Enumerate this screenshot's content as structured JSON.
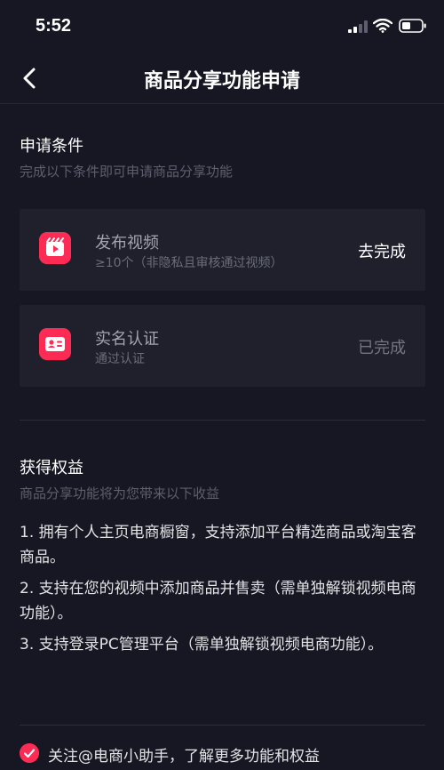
{
  "status_bar": {
    "time": "5:52",
    "icons": [
      "signal-icon",
      "wifi-icon",
      "battery-icon"
    ]
  },
  "nav": {
    "back_icon": "back-arrow-icon",
    "title": "商品分享功能申请"
  },
  "requirements": {
    "title": "申请条件",
    "subtitle": "完成以下条件即可申请商品分享功能",
    "items": [
      {
        "icon": "video-icon",
        "title": "发布视频",
        "desc": "≥10个（非隐私且审核通过视频）",
        "action": "去完成"
      },
      {
        "icon": "id-card-icon",
        "title": "实名认证",
        "desc": "通过认证",
        "action": "已完成"
      }
    ]
  },
  "benefits": {
    "title": "获得权益",
    "subtitle": "商品分享功能将为您带来以下收益",
    "items": [
      "1. 拥有个人主页电商橱窗，支持添加平台精选商品或淘宝客商品。",
      "2. 支持在您的视频中添加商品并售卖（需单独解锁视频电商功能）。",
      "3. 支持登录PC管理平台（需单独解锁视频电商功能）。"
    ]
  },
  "follow": {
    "checked": true,
    "icon": "check-circle-icon",
    "text": "关注@电商小助手，了解更多功能和权益"
  },
  "colors": {
    "background": "#161722",
    "card": "#1f202c",
    "accent": "#fe2c55",
    "muted": "#5d5f6e"
  }
}
